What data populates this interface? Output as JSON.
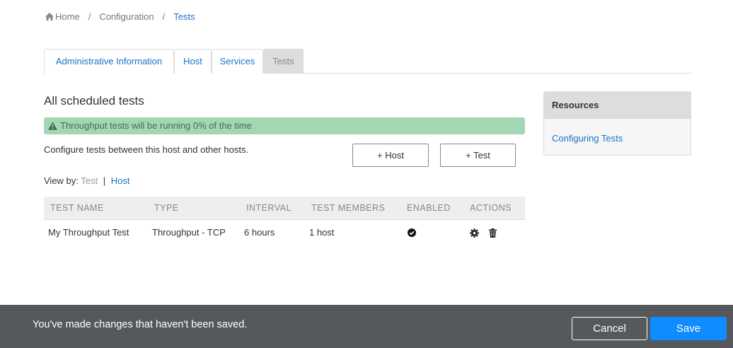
{
  "breadcrumb": {
    "home_icon": "home-icon",
    "home": "Home",
    "separator": "/",
    "config": "Configuration",
    "current": "Tests"
  },
  "tabs": [
    {
      "label": "Administrative Information",
      "active": false
    },
    {
      "label": "Host",
      "active": false
    },
    {
      "label": "Services",
      "active": false
    },
    {
      "label": "Tests",
      "active": true
    }
  ],
  "main": {
    "title": "All scheduled tests",
    "alert_icon": "warning-icon",
    "alert": "Throughput tests will be running 0% of the time",
    "description": "Configure tests between this host and other hosts.",
    "add_host_label": "+ Host",
    "add_test_label": "+ Test",
    "view_by": {
      "label": "View by:",
      "option_test": "Test",
      "divider": "|",
      "option_host": "Host"
    }
  },
  "table": {
    "columns": [
      "TEST NAME",
      "TYPE",
      "INTERVAL",
      "TEST MEMBERS",
      "ENABLED",
      "ACTIONS"
    ],
    "rows": [
      {
        "name": "My Throughput Test",
        "type": "Throughput - TCP",
        "interval": "6 hours",
        "members": "1 host",
        "enabled_icon": "check-circle-icon",
        "action_icons": [
          "gear-icon",
          "trash-icon"
        ]
      }
    ]
  },
  "sidebar": {
    "title": "Resources",
    "link": "Configuring Tests"
  },
  "footer": {
    "message": "You've made changes that haven't been saved.",
    "cancel_label": "Cancel",
    "save_label": "Save"
  },
  "colors": {
    "link": "#1a73c8",
    "alert_bg": "#a3d7b4",
    "footer_bg": "#55595c",
    "save_bg": "#0f8cff"
  }
}
